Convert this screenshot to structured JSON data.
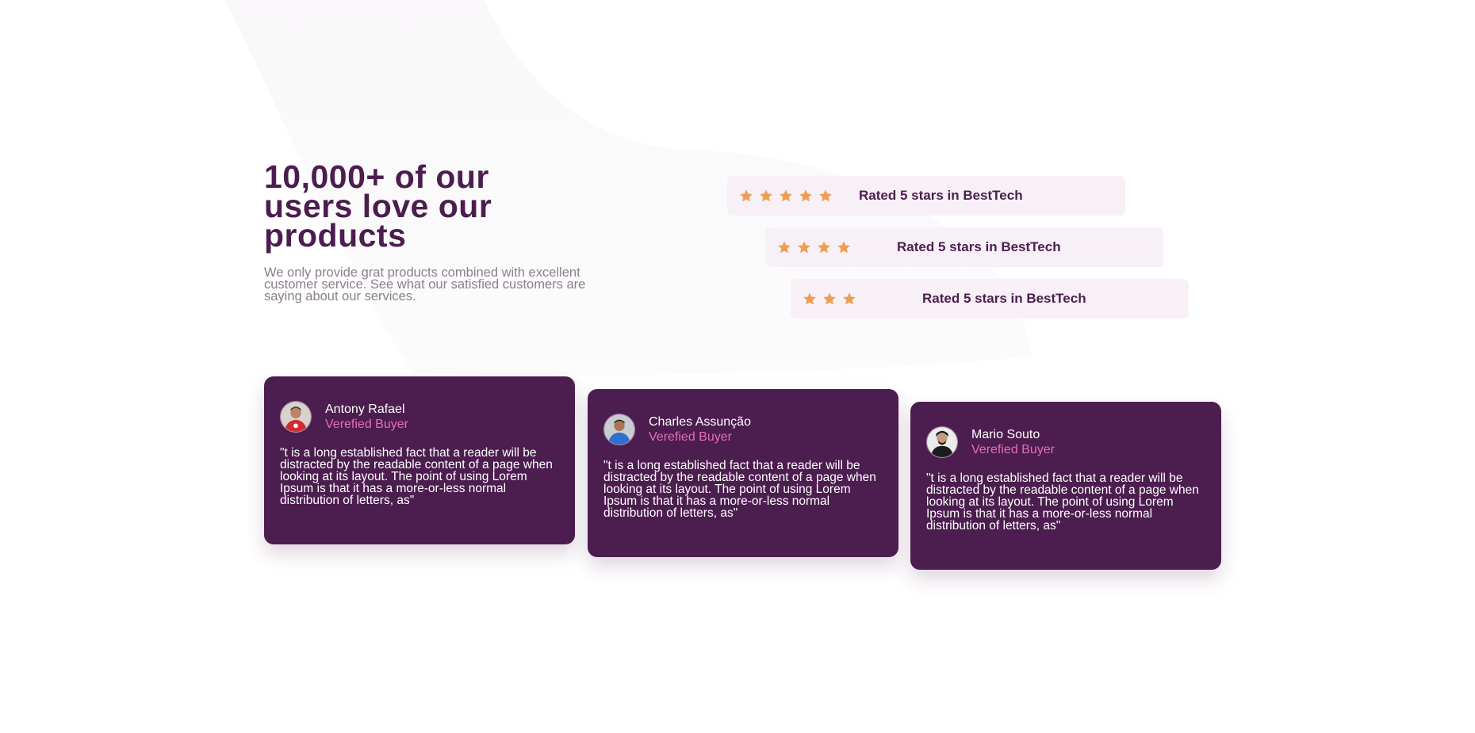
{
  "colors": {
    "accent": "#4c1d4f",
    "pink": "#e66fb7",
    "star": "#ee9d52",
    "rating_bg": "#f7f0f7",
    "muted": "#8a7f8b"
  },
  "hero": {
    "title": "10,000+ of our users love our products",
    "subtitle": "We only provide grat products combined with excellent customer service. See what our satisfied customers are saying about our services."
  },
  "ratings": [
    {
      "stars_shown": 5,
      "text": "Rated 5 stars in BestTech"
    },
    {
      "stars_shown": 4,
      "text": "Rated 5 stars in BestTech"
    },
    {
      "stars_shown": 3,
      "text": "Rated 5 stars in BestTech"
    }
  ],
  "testimonials": [
    {
      "name": "Antony Rafael",
      "badge": "Verefied Buyer",
      "avatar_icon": "avatar-red-shirt-icon",
      "quote": "\"t is a long established fact that a reader will be distracted by the readable content of a page when looking at its layout. The point of using Lorem Ipsum is that it has a more-or-less normal distribution of letters, as\""
    },
    {
      "name": "Charles Assunção",
      "badge": "Verefied Buyer",
      "avatar_icon": "avatar-blue-shirt-icon",
      "quote": "\"t is a long established fact that a reader will be distracted by the readable content of a page when looking at its layout. The point of using Lorem Ipsum is that it has a more-or-less normal distribution of letters, as\""
    },
    {
      "name": "Mario Souto",
      "badge": "Verefied Buyer",
      "avatar_icon": "avatar-dark-shirt-icon",
      "quote": "\"t is a long established fact that a reader will be distracted by the readable content of a page when looking at its layout. The point of using Lorem Ipsum is that it has a more-or-less normal distribution of letters, as\""
    }
  ]
}
